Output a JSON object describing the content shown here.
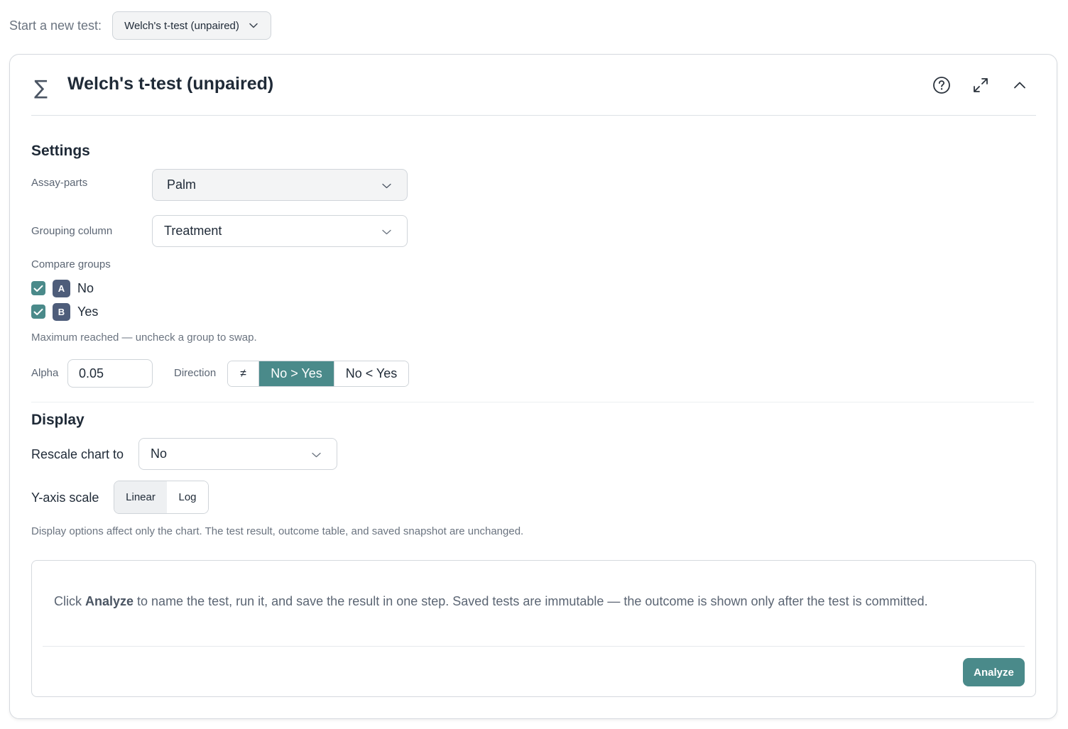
{
  "top": {
    "label": "Start a new test:",
    "test_select_value": "Welch's t-test (unpaired)"
  },
  "card": {
    "title": "Welch's t-test (unpaired)",
    "icons": [
      "sigma-icon",
      "help-icon",
      "expand-icon",
      "collapse-icon"
    ]
  },
  "settings": {
    "title": "Settings",
    "assay_parts_label": "Assay-parts",
    "assay_parts_value": "Palm",
    "grouping_label": "Grouping column",
    "grouping_value": "Treatment",
    "compare_label": "Compare groups",
    "groups": [
      {
        "badge": "A",
        "name": "No",
        "checked": true
      },
      {
        "badge": "B",
        "name": "Yes",
        "checked": true
      }
    ],
    "max_hint": "Maximum reached — uncheck a group to swap.",
    "alpha_label": "Alpha",
    "alpha_value": "0.05",
    "direction_label": "Direction",
    "direction_options": [
      "≠",
      "No > Yes",
      "No < Yes"
    ],
    "direction_selected": "No > Yes"
  },
  "display": {
    "title": "Display",
    "rescale_label": "Rescale chart to",
    "rescale_value": "No",
    "yaxis_label": "Y-axis scale",
    "yaxis_options": [
      "Linear",
      "Log"
    ],
    "yaxis_selected": "Linear",
    "note": "Display options affect only the chart. The test result, outcome table, and saved snapshot are unchanged."
  },
  "result": {
    "text_prefix": "Click ",
    "text_bold": "Analyze",
    "text_suffix": " to name the test, run it, and save the result in one step. Saved tests are immutable — the outcome is shown only after the test is committed.",
    "analyze_label": "Analyze"
  },
  "colors": {
    "accent": "#4a8a8a",
    "badge": "#4e5d7a"
  }
}
